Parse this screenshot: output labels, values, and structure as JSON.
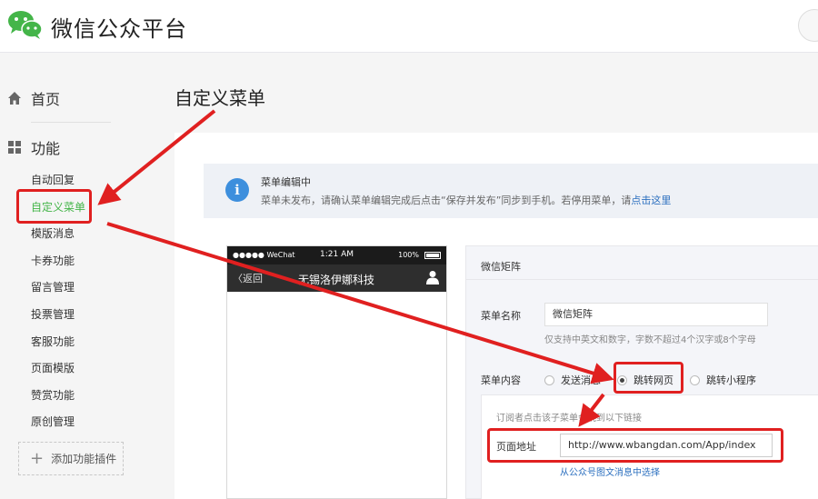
{
  "header": {
    "brand": "微信公众平台",
    "logo_icon": "wechat-logo-icon"
  },
  "sidebar": {
    "home_label": "首页",
    "features_label": "功能",
    "items": [
      {
        "label": "自动回复",
        "active": false
      },
      {
        "label": "自定义菜单",
        "active": true
      },
      {
        "label": "模版消息",
        "active": false
      },
      {
        "label": "卡券功能",
        "active": false
      },
      {
        "label": "留言管理",
        "active": false
      },
      {
        "label": "投票管理",
        "active": false
      },
      {
        "label": "客服功能",
        "active": false
      },
      {
        "label": "页面模版",
        "active": false
      },
      {
        "label": "赞赏功能",
        "active": false
      },
      {
        "label": "原创管理",
        "active": false
      }
    ],
    "add_plugin": "添加功能插件",
    "active_color": "#44b549"
  },
  "page": {
    "title": "自定义菜单"
  },
  "notice": {
    "title": "菜单编辑中",
    "text": "菜单未发布，请确认菜单编辑完成后点击“保存并发布”同步到手机。若停用菜单，请",
    "link": "点击这里"
  },
  "phone": {
    "carrier": "●●●●● WeChat",
    "time": "1:21 AM",
    "battery": "100%",
    "back": "返回",
    "title": "无锡洛伊娜科技"
  },
  "editor": {
    "heading": "微信矩阵",
    "name_label": "菜单名称",
    "name_value": "微信矩阵",
    "name_hint": "仅支持中英文和数字，字数不超过4个汉字或8个字母",
    "content_label": "菜单内容",
    "options": [
      {
        "label": "发送消息",
        "checked": false
      },
      {
        "label": "跳转网页",
        "checked": true
      },
      {
        "label": "跳转小程序",
        "checked": false
      }
    ],
    "sub_hint": "订阅者点击该子菜单会跳到以下链接",
    "url_label": "页面地址",
    "url_value": "http://www.wbangdan.com/App/index",
    "select_link": "从公众号图文消息中选择"
  },
  "annotation_color": "#e02020"
}
